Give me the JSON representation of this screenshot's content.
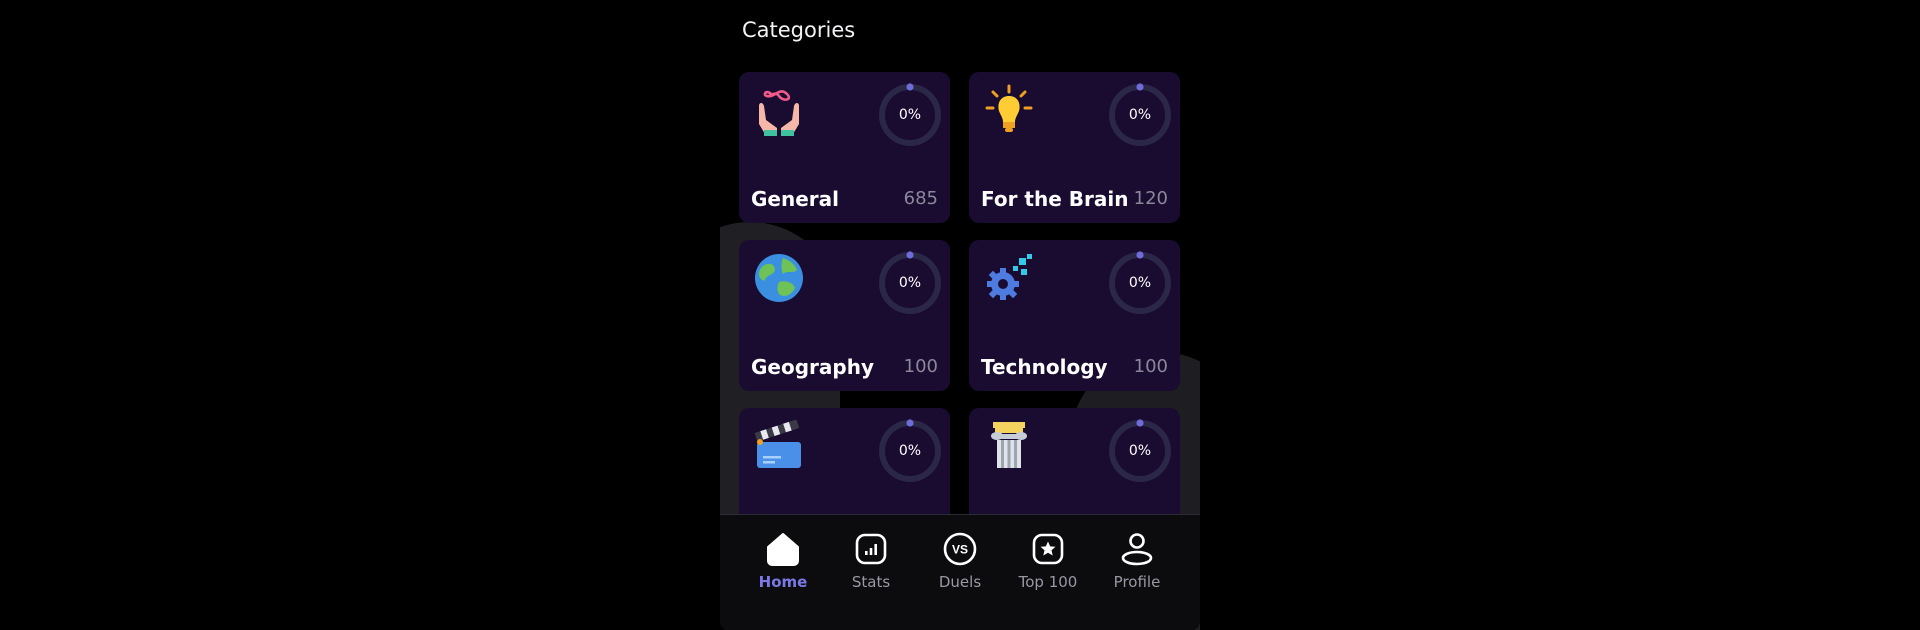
{
  "section_title": "Categories",
  "colors": {
    "card_bg": "#1a0b30",
    "ring_track": "#2a2747",
    "ring_dot": "#6f6bd9",
    "accent": "#7b79e5"
  },
  "categories": [
    {
      "name": "General",
      "count": "685",
      "progress": "0%",
      "icon": "infinity-hands-icon"
    },
    {
      "name": "For the Brain",
      "count": "120",
      "progress": "0%",
      "icon": "lightbulb-icon"
    },
    {
      "name": "Geography",
      "count": "100",
      "progress": "0%",
      "icon": "globe-icon"
    },
    {
      "name": "Technology",
      "count": "100",
      "progress": "0%",
      "icon": "gear-pixels-icon"
    },
    {
      "name": "",
      "count": "",
      "progress": "0%",
      "icon": "clapperboard-icon"
    },
    {
      "name": "",
      "count": "",
      "progress": "0%",
      "icon": "column-icon"
    }
  ],
  "nav": [
    {
      "label": "Home",
      "icon": "home-icon",
      "active": true
    },
    {
      "label": "Stats",
      "icon": "stats-icon",
      "active": false
    },
    {
      "label": "Duels",
      "icon": "versus-icon",
      "active": false
    },
    {
      "label": "Top 100",
      "icon": "star-badge-icon",
      "active": false
    },
    {
      "label": "Profile",
      "icon": "profile-icon",
      "active": false
    }
  ]
}
